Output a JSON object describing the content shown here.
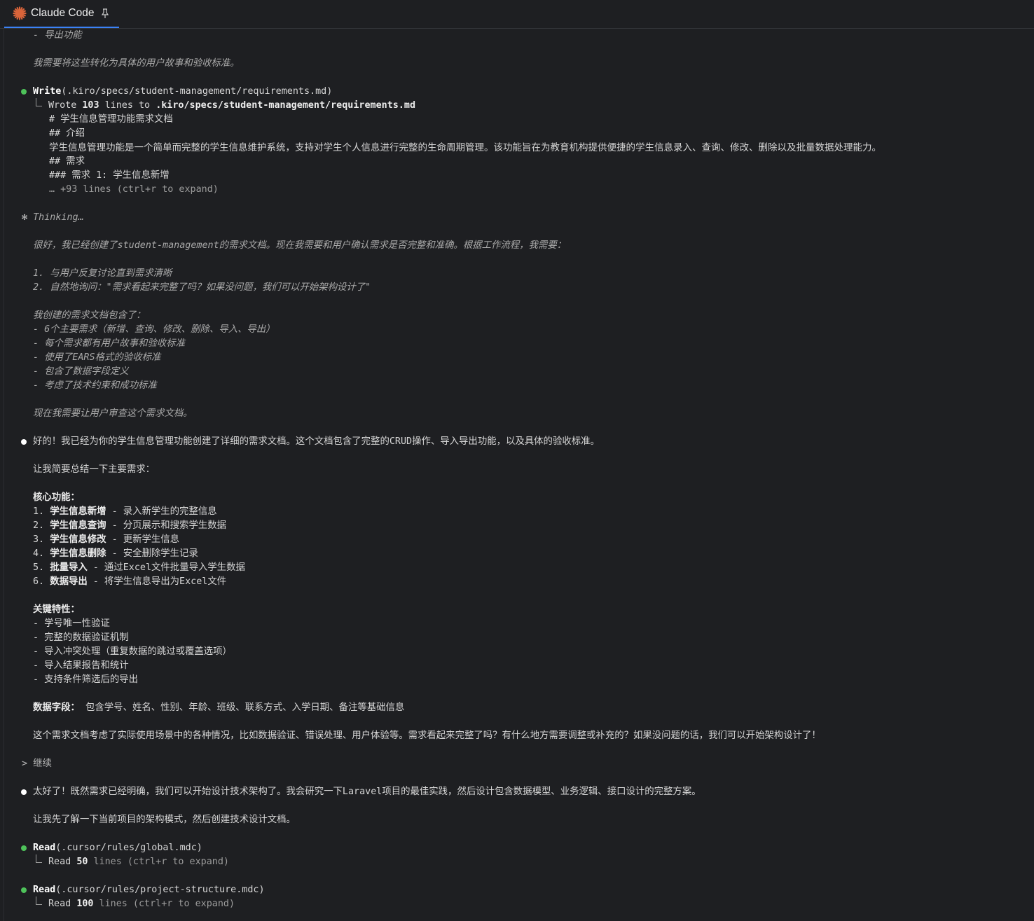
{
  "app": {
    "title": "Claude Code"
  },
  "lines": {
    "l1": "- 导出功能",
    "l2": "我需要将这些转化为具体的用户故事和验收标准。",
    "write_tool": "Write",
    "write_args": "(.kiro/specs/student-management/requirements.md)",
    "wrote_prefix": "Wrote ",
    "wrote_count": "103",
    "wrote_mid": " lines to ",
    "wrote_path": ".kiro/specs/student-management/requirements.md",
    "md1": "# 学生信息管理功能需求文档",
    "md2": "## 介绍",
    "md3": "学生信息管理功能是一个简单而完整的学生信息维护系统，支持对学生个人信息进行完整的生命周期管理。该功能旨在为教育机构提供便捷的学生信息录入、查询、修改、删除以及批量数据处理能力。",
    "md4": "## 需求",
    "md5": "### 需求 1: 学生信息新增",
    "md6": "… +93 lines (ctrl+r to expand)",
    "thinking_star": "✻",
    "thinking": "Thinking…",
    "t1": "很好，我已经创建了student-management的需求文档。现在我需要和用户确认需求是否完整和准确。根据工作流程，我需要：",
    "t2": "1. 与用户反复讨论直到需求清晰",
    "t3": "2. 自然地询问：\"需求看起来完整了吗？如果没问题，我们可以开始架构设计了\"",
    "t4": "我创建的需求文档包含了：",
    "t5": "- 6个主要需求（新增、查询、修改、删除、导入、导出）",
    "t6": "- 每个需求都有用户故事和验收标准",
    "t7": "- 使用了EARS格式的验收标准",
    "t8": "- 包含了数据字段定义",
    "t9": "- 考虑了技术约束和成功标准",
    "t10": "现在我需要让用户审查这个需求文档。",
    "r1": "好的！我已经为你的学生信息管理功能创建了详细的需求文档。这个文档包含了完整的CRUD操作、导入导出功能，以及具体的验收标准。",
    "r2": "让我简要总结一下主要需求：",
    "core_title": "核心功能：",
    "core": [
      {
        "num": "1. ",
        "name": "学生信息新增",
        "desc": " - 录入新学生的完整信息"
      },
      {
        "num": "2. ",
        "name": "学生信息查询",
        "desc": " - 分页展示和搜索学生数据"
      },
      {
        "num": "3. ",
        "name": "学生信息修改",
        "desc": " - 更新学生信息"
      },
      {
        "num": "4. ",
        "name": "学生信息删除",
        "desc": " - 安全删除学生记录"
      },
      {
        "num": "5. ",
        "name": "批量导入",
        "desc": " - 通过Excel文件批量导入学生数据"
      },
      {
        "num": "6. ",
        "name": "数据导出",
        "desc": " - 将学生信息导出为Excel文件"
      }
    ],
    "key_title": "关键特性：",
    "k1": "- 学号唯一性验证",
    "k2": "- 完整的数据验证机制",
    "k3": "- 导入冲突处理（重复数据的跳过或覆盖选项）",
    "k4": "- 导入结果报告和统计",
    "k5": "- 支持条件筛选后的导出",
    "fields_title": "数据字段：",
    "fields": " 包含学号、姓名、性别、年龄、班级、联系方式、入学日期、备注等基础信息",
    "closing": "这个需求文档考虑了实际使用场景中的各种情况，比如数据验证、错误处理、用户体验等。需求看起来完整了吗？有什么地方需要调整或补充的？如果没问题的话，我们可以开始架构设计了！",
    "user_prompt": "> 继续",
    "r3": "太好了！既然需求已经明确，我们可以开始设计技术架构了。我会研究一下Laravel项目的最佳实践，然后设计包含数据模型、业务逻辑、接口设计的完整方案。",
    "r4": "让我先了解一下当前项目的架构模式，然后创建技术设计文档。",
    "read_tool": "Read",
    "read1_args": "(.cursor/rules/global.mdc)",
    "read1_prefix": "Read ",
    "read1_count": "50",
    "read1_suffix": " lines (ctrl+r to expand)",
    "read2_args": "(.cursor/rules/project-structure.mdc)",
    "read2_prefix": "Read ",
    "read2_count": "100",
    "read2_suffix": " lines (ctrl+r to expand)"
  },
  "colors": {
    "accent": "#3b82f6",
    "success_dot": "#4ec25a",
    "logo": "#d9643a"
  }
}
